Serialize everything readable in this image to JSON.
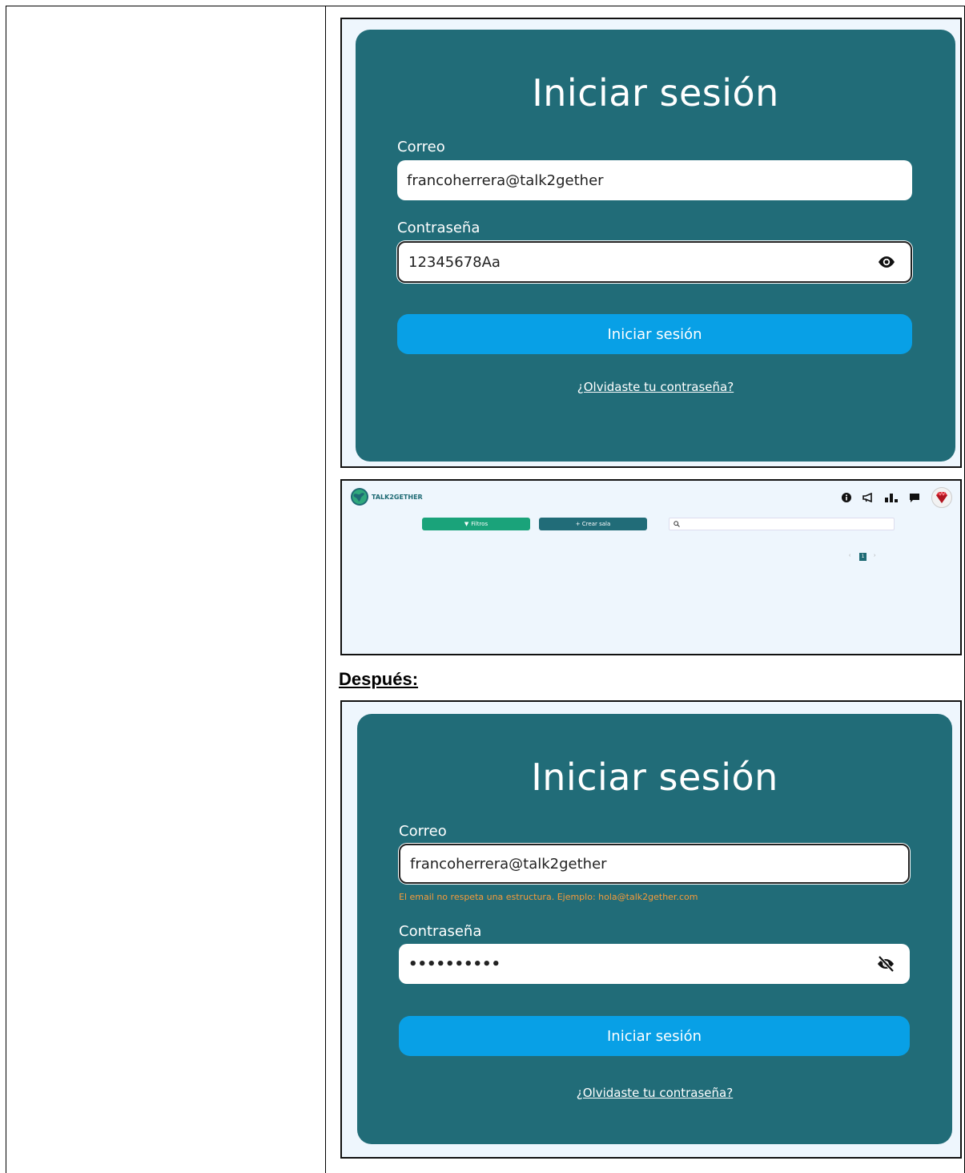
{
  "before": {
    "title": "Iniciar sesión",
    "email_label": "Correo",
    "email_value": "francoherrera@talk2gether",
    "password_label": "Contraseña",
    "password_value": "12345678Aa",
    "submit_label": "Iniciar sesión",
    "forgot_link": "¿Olvidaste tu contraseña?",
    "eye_icon": "eye-icon"
  },
  "app": {
    "brand": "TALK2GETHER",
    "filters_label": "Filtros",
    "create_room_label": "+ Crear sala",
    "page_number": "1",
    "colors": {
      "filters": "#1aa37a",
      "create": "#216c78",
      "background": "#eef6fd"
    }
  },
  "after": {
    "section_heading": "Después:",
    "title": "Iniciar sesión",
    "email_label": "Correo",
    "email_value": "francoherrera@talk2gether",
    "email_error": "El email no respeta una estructura. Ejemplo: hola@talk2gether.com",
    "password_label": "Contraseña",
    "password_value": "••••••••••",
    "submit_label": "Iniciar sesión",
    "forgot_link": "¿Olvidaste tu contraseña?",
    "eye_icon": "eye-slash-icon"
  },
  "colors": {
    "card": "#216c78",
    "button": "#08a0e6",
    "error": "#f59a3a"
  }
}
